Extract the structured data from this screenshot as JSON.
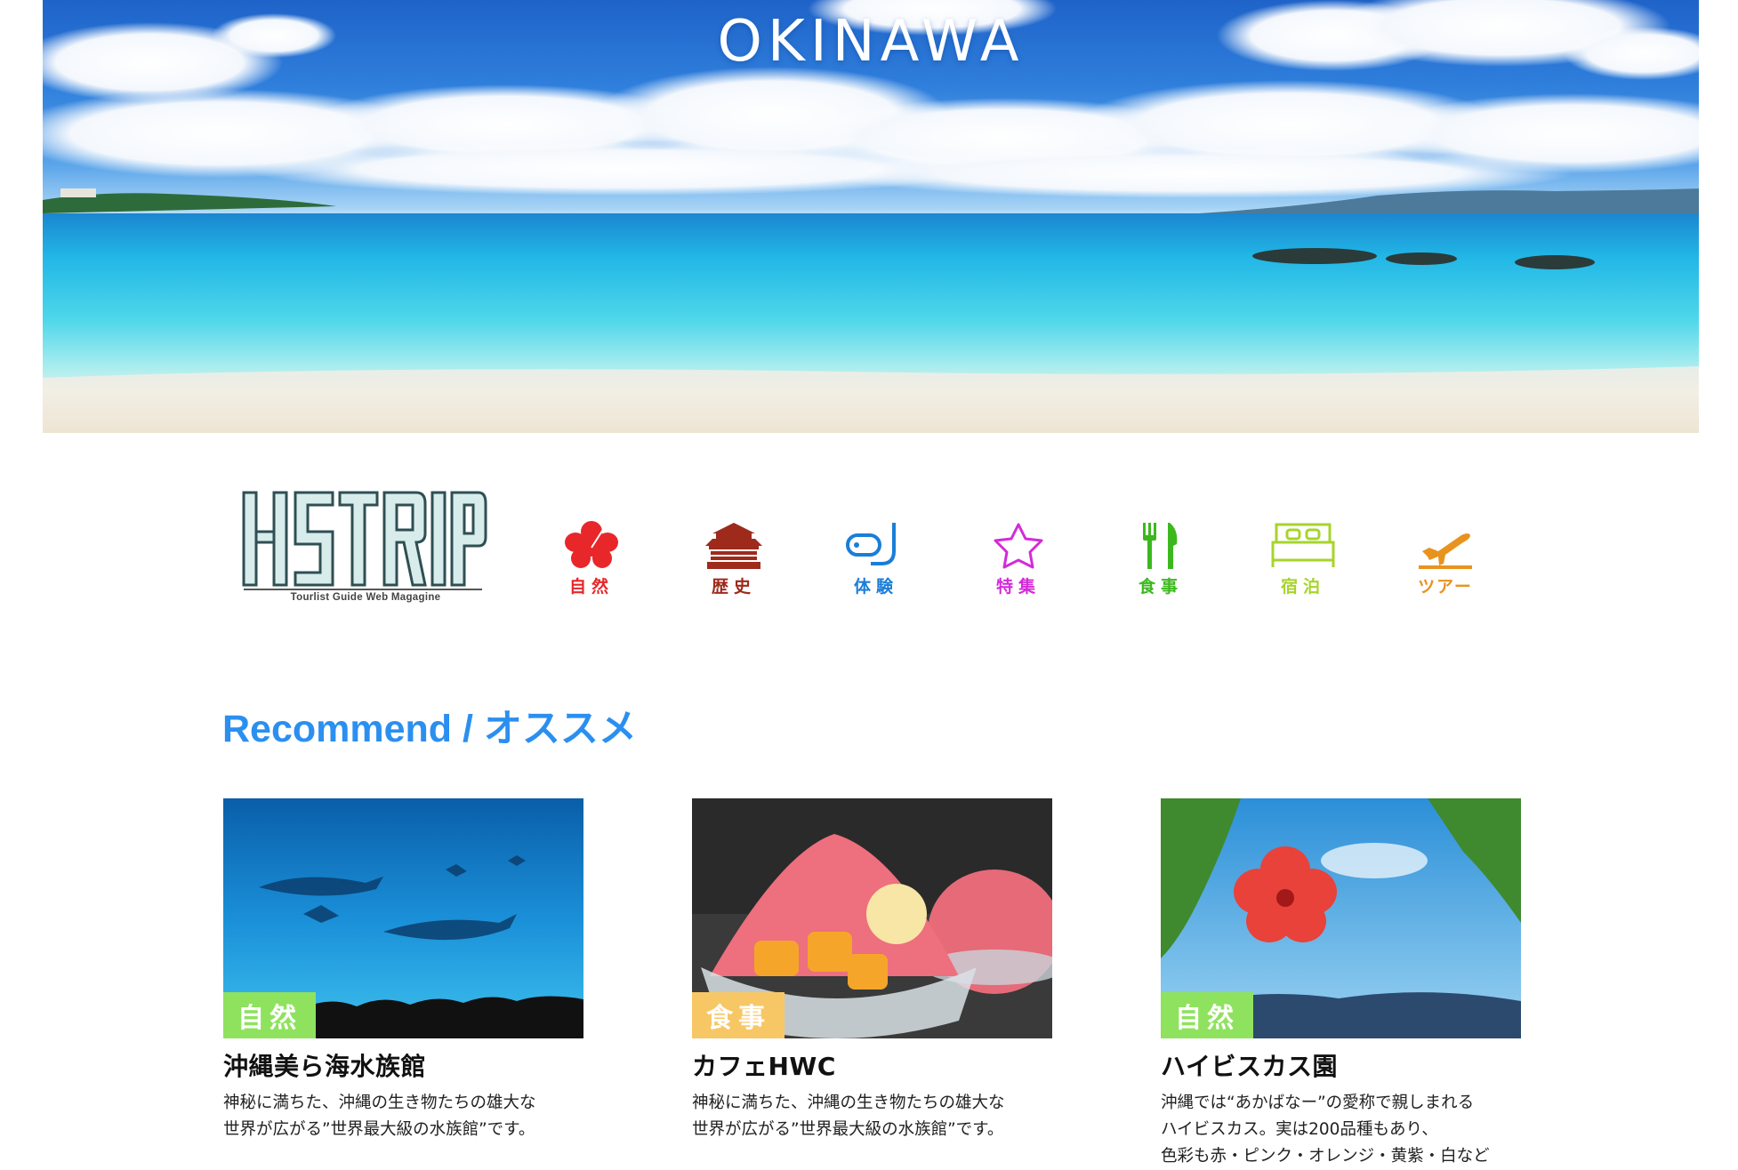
{
  "hero": {
    "title": "OKINAWA"
  },
  "logo": {
    "name": "HSTRIP",
    "tagline": "Tourlist Guide Web Magagine"
  },
  "nav": {
    "items": [
      {
        "label": "自然",
        "icon": "hibiscus-icon",
        "color": "#e8272b"
      },
      {
        "label": "歴史",
        "icon": "shuri-castle-icon",
        "color": "#9e2a1c"
      },
      {
        "label": "体験",
        "icon": "snorkel-icon",
        "color": "#1a7ed8"
      },
      {
        "label": "特集",
        "icon": "star-icon",
        "color": "#d22bd8"
      },
      {
        "label": "食事",
        "icon": "fork-knife-icon",
        "color": "#3cb81e"
      },
      {
        "label": "宿泊",
        "icon": "bed-icon",
        "color": "#a7d42b"
      },
      {
        "label": "ツアー",
        "icon": "airplane-icon",
        "color": "#e8931e"
      }
    ]
  },
  "recommend": {
    "title": "Recommend / オススメ",
    "cards": [
      {
        "tag": "自然",
        "tag_color": "#8fe25e",
        "title": "沖縄美ら海水族館",
        "description": "神秘に満ちた、沖縄の生き物たちの雄大な\n世界が広がる”世界最大級の水族館”です。",
        "image": "aquarium-photo"
      },
      {
        "tag": "食事",
        "tag_color": "#f7c766",
        "title": "カフェHWC",
        "description": "神秘に満ちた、沖縄の生き物たちの雄大な\n世界が広がる”世界最大級の水族館”です。",
        "image": "shaved-ice-photo"
      },
      {
        "tag": "自然",
        "tag_color": "#8fe25e",
        "title": "ハイビスカス園",
        "description": "沖縄では“あかばなー”の愛称で親しまれる\nハイビスカス。実は200品種もあり、\n色彩も赤・ピンク・オレンジ・黄紫・白など",
        "image": "hibiscus-photo"
      }
    ]
  }
}
